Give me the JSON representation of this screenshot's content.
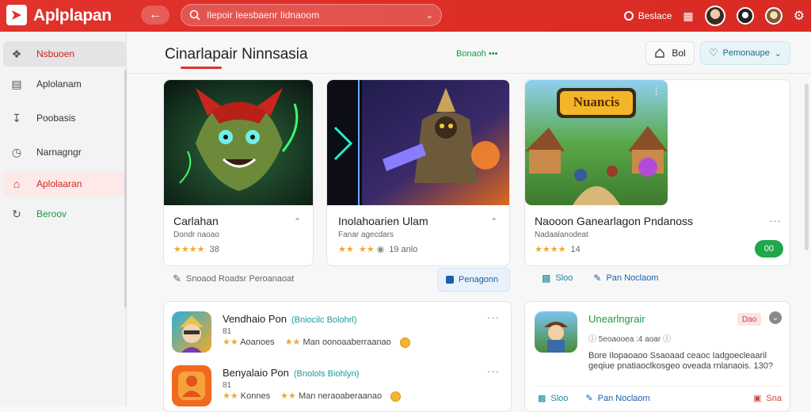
{
  "topbar": {
    "app_title": "Aplplapan",
    "search_placeholder": "Ilepoir Ieesbaenr Iidnaoom",
    "right_label": "Beslace"
  },
  "sidebar": {
    "items": [
      {
        "label": "Nsbuoen",
        "icon": "puzzle-icon"
      },
      {
        "label": "Aplolanam",
        "icon": "list-icon"
      },
      {
        "label": "Poobasis",
        "icon": "download-icon"
      },
      {
        "label": "Narnagngr",
        "icon": "clock-icon"
      },
      {
        "label": "Aplolaaran",
        "icon": "home-icon"
      },
      {
        "label": "Beroov",
        "icon": "refresh-icon"
      }
    ]
  },
  "header": {
    "title": "Cinarlapair Ninnsasia",
    "link": "Bonaoh •••",
    "share_label": "Bol",
    "dropdown_label": "Pemonaupe"
  },
  "cards": [
    {
      "title": "Carlahan",
      "subtitle": "Dondr naoao",
      "rating": "38",
      "action_left": "Snoaod Roadsr Peroanaoat"
    },
    {
      "title": "Inolahoarien Ulam",
      "subtitle": "Fanar agecdars",
      "rating": "19 anlo",
      "action_right": "Penagonn"
    },
    {
      "title": "Naooon Ganearlagon Pndanoss",
      "subtitle": "Nadaalanodeat",
      "rating": "14",
      "badge": "00",
      "action_left": "Sloo",
      "action_right": "Pan Noclaom",
      "game_logo": "Nuancis"
    }
  ],
  "list": [
    {
      "title": "Vendhaio Pon",
      "tag": "(Bniocilc Bolohrl)",
      "sub": "81",
      "meta_left": "Aoanoes",
      "meta_right": "Man oonoaaberraanao"
    },
    {
      "title": "Benyalaio Pon",
      "tag": "(Bnolols Biohlyn)",
      "sub": "81",
      "meta_left": "Konnes",
      "meta_right": "Man neraoaberaanao"
    }
  ],
  "side_panel": {
    "title": "Unearlngrair",
    "version": "5eoaooea  :4  aoar",
    "badge": "Dao",
    "description": "Bore Ilopaoaoo Ssaoaad ceaoc Iadgoecleaaril geqiue pnatiaoclkosgeo oveada rnlanaois. 130?",
    "action_left": "Sloo",
    "action_mid": "Pan Noclaom",
    "action_right": "Sna"
  },
  "colors": {
    "brand": "#e1322b",
    "accent_green": "#1fa84a",
    "link_blue": "#1d5fa8",
    "star": "#f2a72c"
  }
}
